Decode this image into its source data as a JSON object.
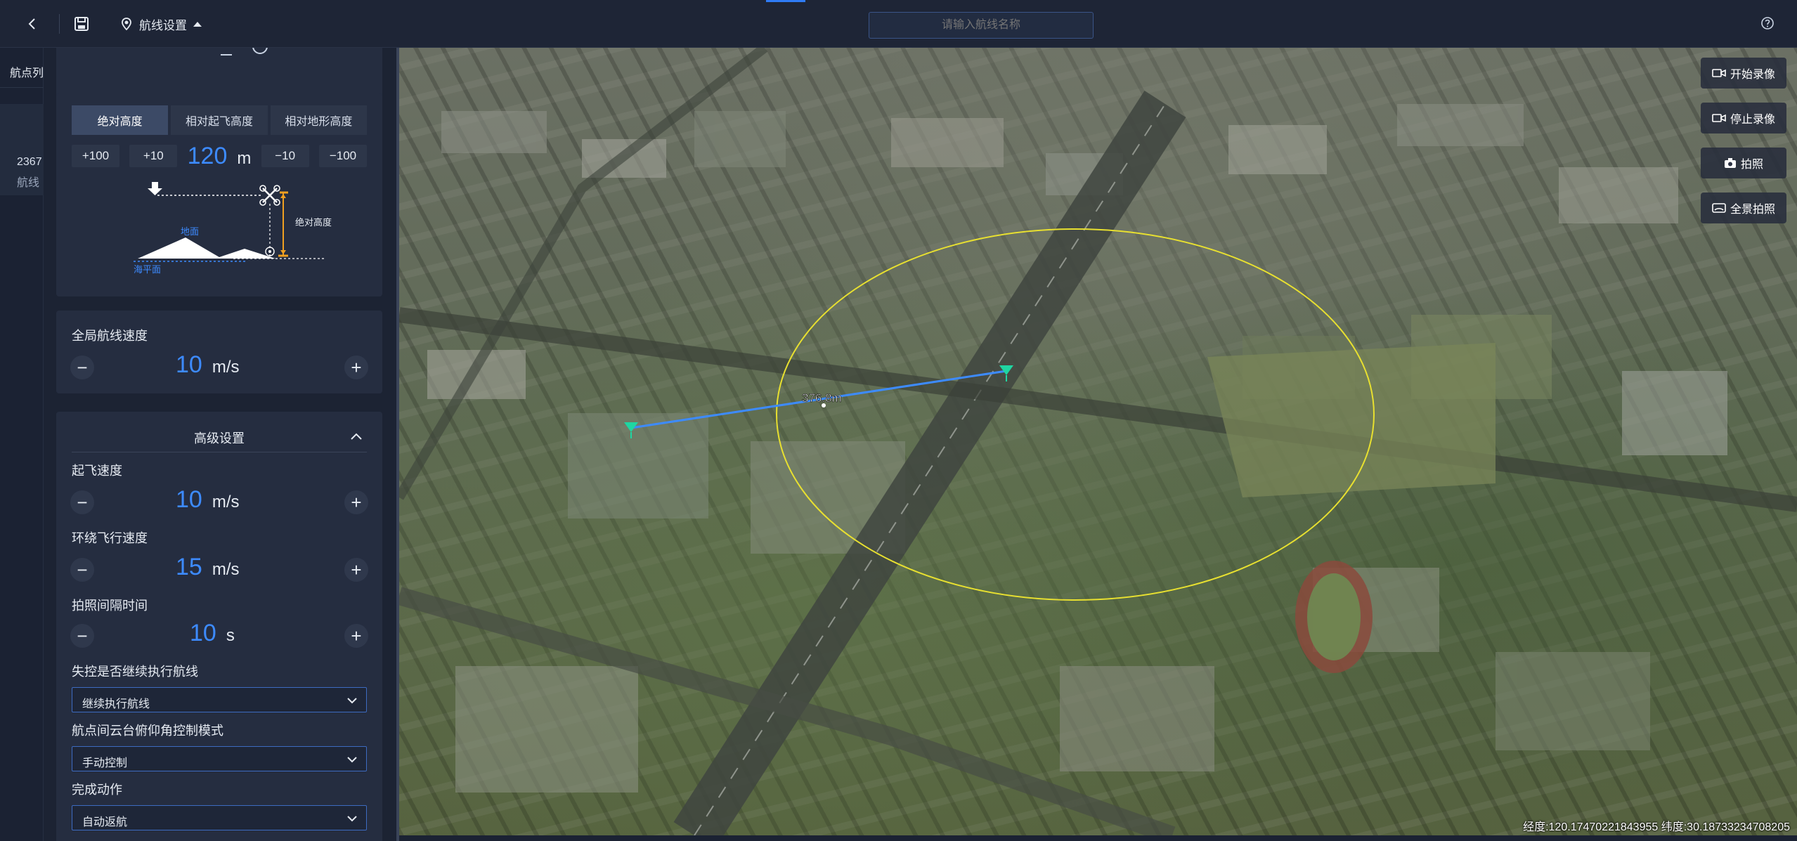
{
  "topbar": {
    "route_settings_label": "航线设置",
    "route_name_placeholder": "请输入航线名称",
    "icons": [
      "back-icon",
      "save-icon",
      "route-pin-icon",
      "caret-up-icon",
      "help-icon"
    ]
  },
  "strip": {
    "tab_label": "航点列",
    "item_line1": "2367",
    "item_line2": "航线"
  },
  "height": {
    "modes": [
      "绝对高度",
      "相对起飞高度",
      "相对地形高度"
    ],
    "active_mode_index": 0,
    "inc100": "+100",
    "inc10": "+10",
    "value": "120",
    "unit": "m",
    "dec10": "−10",
    "dec100": "−100",
    "diagram": {
      "ground_label": "地面",
      "sea_level_label": "海平面",
      "abs_height_label": "绝对高度"
    }
  },
  "global_speed": {
    "label": "全局航线速度",
    "value": "10",
    "unit": "m/s"
  },
  "advanced": {
    "title": "高级设置",
    "takeoff_speed": {
      "label": "起飞速度",
      "value": "10",
      "unit": "m/s"
    },
    "orbit_speed": {
      "label": "环绕飞行速度",
      "value": "15",
      "unit": "m/s"
    },
    "photo_interval": {
      "label": "拍照间隔时间",
      "value": "10",
      "unit": "s"
    },
    "lost_control": {
      "label": "失控是否继续执行航线",
      "value": "继续执行航线"
    },
    "gimbal_mode": {
      "label": "航点间云台俯仰角控制模式",
      "value": "手动控制"
    },
    "finish_action": {
      "label": "完成动作",
      "value": "自动返航"
    }
  },
  "map": {
    "distance_label": "376.8m",
    "coords_text": "经度:120.17470221843955  纬度:30.18733234708205",
    "buttons": {
      "start_record": "开始录像",
      "stop_record": "停止录像",
      "photo": "拍照",
      "panorama": "全景拍照"
    },
    "circle_color": "#e8e030",
    "route_color": "#3d8bff",
    "waypoint_color": "#1fd6a2"
  },
  "colors": {
    "accent": "#3d8bff",
    "panel_bg": "#1c2333",
    "card_bg": "#252d40"
  }
}
